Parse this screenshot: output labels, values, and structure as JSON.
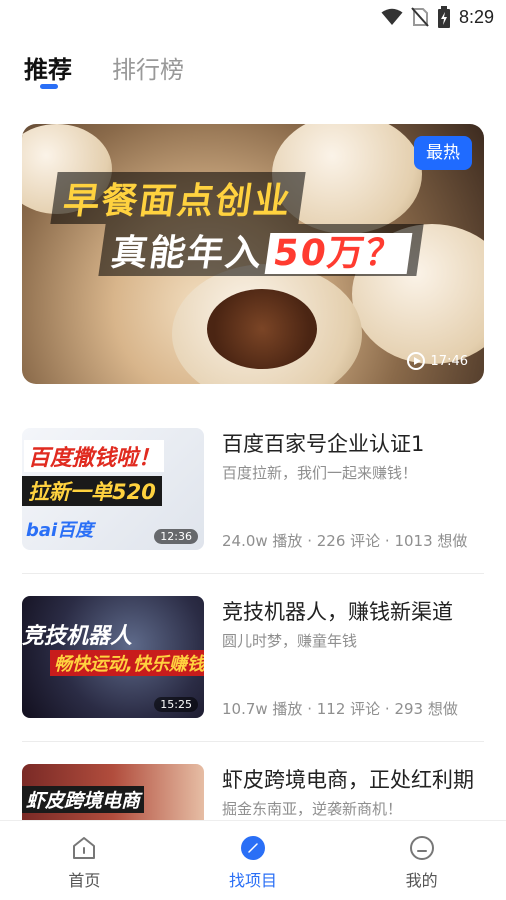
{
  "status_bar": {
    "time": "8:29",
    "icons": [
      "wifi-icon",
      "no-sim-icon",
      "battery-charging-icon"
    ]
  },
  "top_tabs": [
    {
      "label": "推荐",
      "active": true
    },
    {
      "label": "排行榜",
      "active": false
    }
  ],
  "hero": {
    "title_line1": "早餐面点创业",
    "title_line2": "真能年入",
    "title_highlight": "50万？",
    "badge": "最热",
    "duration": "17:46"
  },
  "feed": [
    {
      "title": "百度百家号企业认证1",
      "subtitle": "百度拉新，我们一起来赚钱！",
      "stats": "24.0w 播放 · 226 评论 · 1013 想做",
      "thumb_line1": "百度撒钱啦！",
      "thumb_line2": "拉新一单520",
      "thumb_brand": "bai百度",
      "duration": "12:36"
    },
    {
      "title": "竞技机器人，赚钱新渠道",
      "subtitle": "圆儿时梦，赚童年钱",
      "stats": "10.7w 播放 · 112 评论 · 293 想做",
      "thumb_line1": "竞技机器人",
      "thumb_line2": "畅快运动,快乐赚钱",
      "duration": "15:25"
    },
    {
      "title": "虾皮跨境电商，正处红利期",
      "subtitle": "掘金东南亚，逆袭新商机！",
      "stats": "",
      "thumb_line1": "虾皮跨境电商",
      "duration": ""
    }
  ],
  "bottom_nav": [
    {
      "label": "首页",
      "icon": "home-icon",
      "active": false
    },
    {
      "label": "找项目",
      "icon": "compass-icon",
      "active": true
    },
    {
      "label": "我的",
      "icon": "profile-icon",
      "active": false
    }
  ],
  "colors": {
    "accent": "#2a6ff6",
    "hot_badge": "#1f6bff",
    "text_primary": "#222222",
    "text_secondary": "#8f8f8f"
  }
}
